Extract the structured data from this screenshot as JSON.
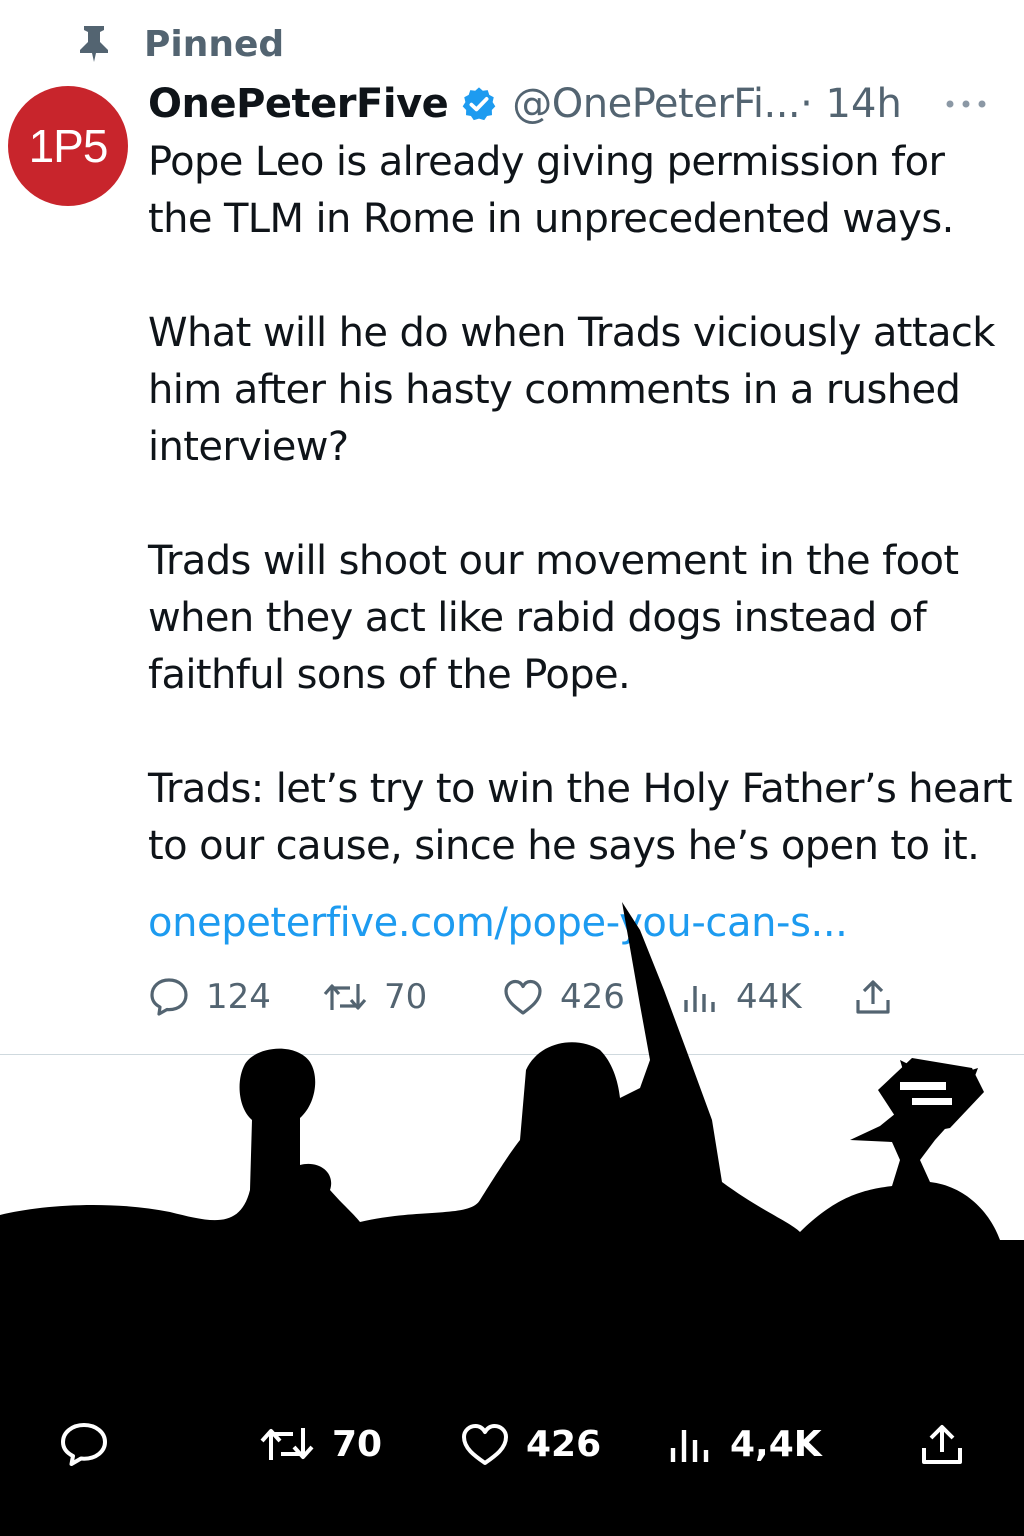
{
  "pinned": {
    "label": "Pinned",
    "icon": "pin-icon"
  },
  "tweet": {
    "avatar_text": "1P5",
    "avatar_color": "#c8252c",
    "display_name": "OnePeterFive",
    "verified_icon": "verified-badge-icon",
    "handle": "@OnePeterFi...",
    "time": "· 14h",
    "more_icon": "more-icon",
    "text": "Pope Leo is already giving permission for\nthe TLM in Rome in unprecedented ways.\n\nWhat will he do when Trads viciously attack\nhim after his hasty comments in a rushed\ninterview?\n\nTrads will shoot our movement in the foot\nwhen they act like rabid dogs instead of\nfaithful sons of the Pope.\n\nTrads: let’s try to win the Holy Father’s heart\nto our cause, since he says he’s open to it.",
    "link": "onepeterfive.com/pope-you-can-s...",
    "link_color": "#1d9bf0"
  },
  "actions": {
    "reply": "124",
    "retweet": "70",
    "like": "426",
    "views": "44K"
  },
  "bottom_actions": {
    "retweet": "70",
    "like": "426",
    "views": "4,4K"
  },
  "colors": {
    "secondary_text": "#536471",
    "silhouette": "#000000"
  }
}
